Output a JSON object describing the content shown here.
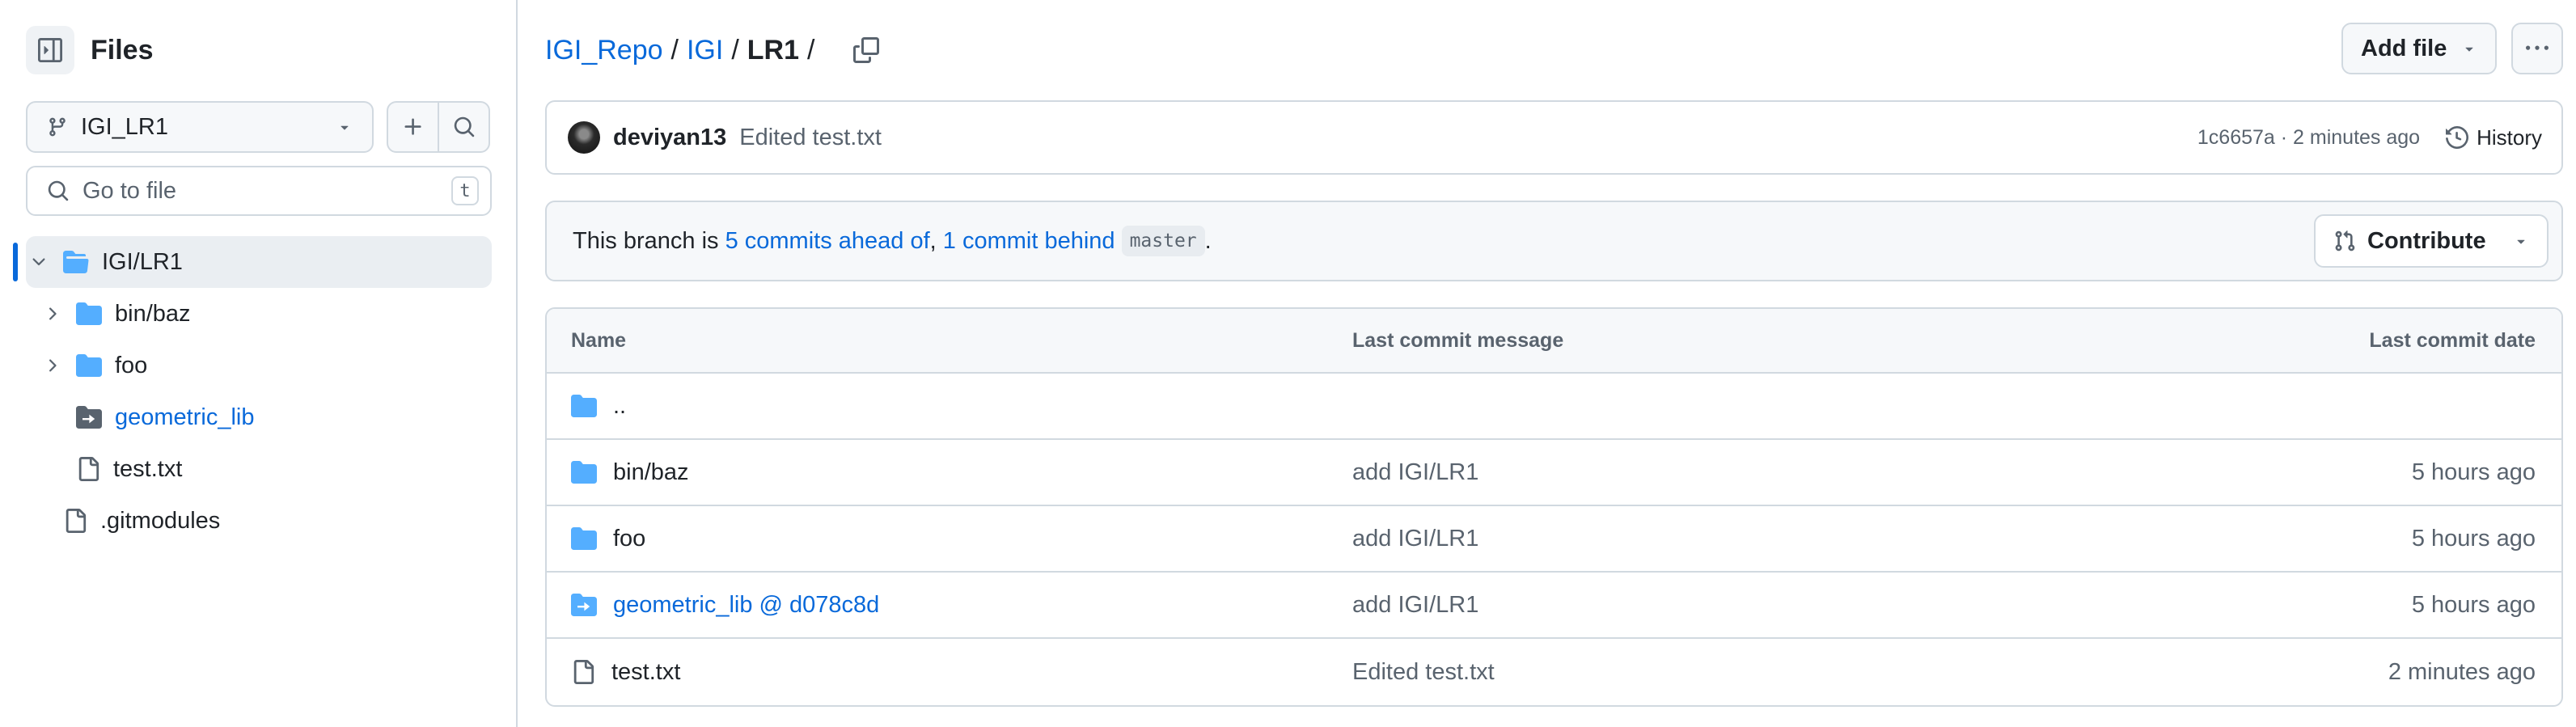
{
  "sidebar": {
    "title": "Files",
    "branch": "IGI_LR1",
    "goto_placeholder": "Go to file",
    "goto_shortcut": "t",
    "tree": [
      {
        "label": "IGI/LR1",
        "kind": "folder-open",
        "link": false
      },
      {
        "label": "bin/baz",
        "kind": "folder",
        "link": false
      },
      {
        "label": "foo",
        "kind": "folder",
        "link": false
      },
      {
        "label": "geometric_lib",
        "kind": "submodule",
        "link": true
      },
      {
        "label": "test.txt",
        "kind": "file",
        "link": false
      },
      {
        "label": ".gitmodules",
        "kind": "file",
        "link": false
      }
    ]
  },
  "breadcrumb": {
    "repo": "IGI_Repo",
    "dir": "IGI",
    "current": "LR1",
    "sep": "/"
  },
  "toolbar": {
    "add_file": "Add file"
  },
  "commit": {
    "author": "deviyan13",
    "message": "Edited test.txt",
    "meta": "1c6657a · 2 minutes ago",
    "history": "History"
  },
  "branch_info": {
    "prefix": "This branch is ",
    "ahead": "5 commits ahead of",
    "comma": ", ",
    "behind": "1 commit behind",
    "base": "master",
    "suffix": ".",
    "contribute": "Contribute"
  },
  "table": {
    "headers": {
      "name": "Name",
      "message": "Last commit message",
      "date": "Last commit date"
    },
    "rows": [
      {
        "name": "..",
        "kind": "folder",
        "message": "",
        "date": ""
      },
      {
        "name": "bin/baz",
        "kind": "folder",
        "message": "add IGI/LR1",
        "date": "5 hours ago"
      },
      {
        "name": "foo",
        "kind": "folder",
        "message": "add IGI/LR1",
        "date": "5 hours ago"
      },
      {
        "name": "geometric_lib @ d078c8d",
        "kind": "submodule",
        "message": "add IGI/LR1",
        "date": "5 hours ago"
      },
      {
        "name": "test.txt",
        "kind": "file",
        "message": "Edited test.txt",
        "date": "2 minutes ago"
      }
    ]
  },
  "colors": {
    "accent": "#0969da",
    "folder": "#54aeff",
    "border": "#d1d9e0",
    "muted": "#59636e"
  }
}
